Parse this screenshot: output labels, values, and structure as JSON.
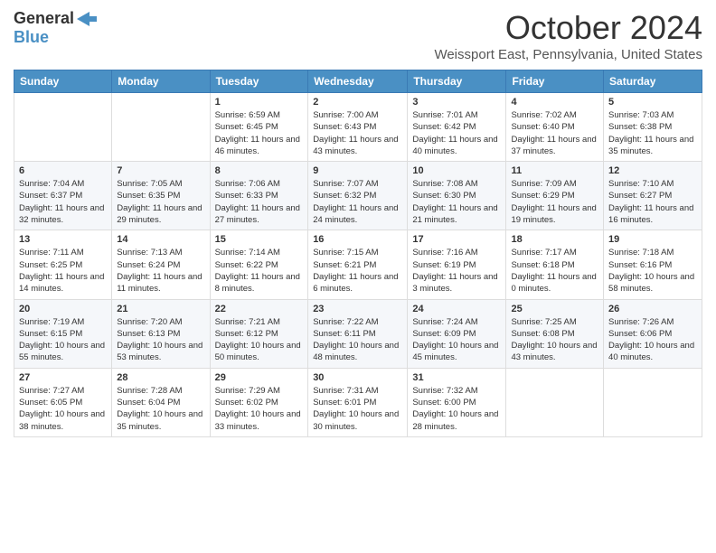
{
  "logo": {
    "general": "General",
    "blue": "Blue"
  },
  "header": {
    "month": "October 2024",
    "location": "Weissport East, Pennsylvania, United States"
  },
  "weekdays": [
    "Sunday",
    "Monday",
    "Tuesday",
    "Wednesday",
    "Thursday",
    "Friday",
    "Saturday"
  ],
  "weeks": [
    [
      {
        "day": "",
        "sunrise": "",
        "sunset": "",
        "daylight": ""
      },
      {
        "day": "",
        "sunrise": "",
        "sunset": "",
        "daylight": ""
      },
      {
        "day": "1",
        "sunrise": "Sunrise: 6:59 AM",
        "sunset": "Sunset: 6:45 PM",
        "daylight": "Daylight: 11 hours and 46 minutes."
      },
      {
        "day": "2",
        "sunrise": "Sunrise: 7:00 AM",
        "sunset": "Sunset: 6:43 PM",
        "daylight": "Daylight: 11 hours and 43 minutes."
      },
      {
        "day": "3",
        "sunrise": "Sunrise: 7:01 AM",
        "sunset": "Sunset: 6:42 PM",
        "daylight": "Daylight: 11 hours and 40 minutes."
      },
      {
        "day": "4",
        "sunrise": "Sunrise: 7:02 AM",
        "sunset": "Sunset: 6:40 PM",
        "daylight": "Daylight: 11 hours and 37 minutes."
      },
      {
        "day": "5",
        "sunrise": "Sunrise: 7:03 AM",
        "sunset": "Sunset: 6:38 PM",
        "daylight": "Daylight: 11 hours and 35 minutes."
      }
    ],
    [
      {
        "day": "6",
        "sunrise": "Sunrise: 7:04 AM",
        "sunset": "Sunset: 6:37 PM",
        "daylight": "Daylight: 11 hours and 32 minutes."
      },
      {
        "day": "7",
        "sunrise": "Sunrise: 7:05 AM",
        "sunset": "Sunset: 6:35 PM",
        "daylight": "Daylight: 11 hours and 29 minutes."
      },
      {
        "day": "8",
        "sunrise": "Sunrise: 7:06 AM",
        "sunset": "Sunset: 6:33 PM",
        "daylight": "Daylight: 11 hours and 27 minutes."
      },
      {
        "day": "9",
        "sunrise": "Sunrise: 7:07 AM",
        "sunset": "Sunset: 6:32 PM",
        "daylight": "Daylight: 11 hours and 24 minutes."
      },
      {
        "day": "10",
        "sunrise": "Sunrise: 7:08 AM",
        "sunset": "Sunset: 6:30 PM",
        "daylight": "Daylight: 11 hours and 21 minutes."
      },
      {
        "day": "11",
        "sunrise": "Sunrise: 7:09 AM",
        "sunset": "Sunset: 6:29 PM",
        "daylight": "Daylight: 11 hours and 19 minutes."
      },
      {
        "day": "12",
        "sunrise": "Sunrise: 7:10 AM",
        "sunset": "Sunset: 6:27 PM",
        "daylight": "Daylight: 11 hours and 16 minutes."
      }
    ],
    [
      {
        "day": "13",
        "sunrise": "Sunrise: 7:11 AM",
        "sunset": "Sunset: 6:25 PM",
        "daylight": "Daylight: 11 hours and 14 minutes."
      },
      {
        "day": "14",
        "sunrise": "Sunrise: 7:13 AM",
        "sunset": "Sunset: 6:24 PM",
        "daylight": "Daylight: 11 hours and 11 minutes."
      },
      {
        "day": "15",
        "sunrise": "Sunrise: 7:14 AM",
        "sunset": "Sunset: 6:22 PM",
        "daylight": "Daylight: 11 hours and 8 minutes."
      },
      {
        "day": "16",
        "sunrise": "Sunrise: 7:15 AM",
        "sunset": "Sunset: 6:21 PM",
        "daylight": "Daylight: 11 hours and 6 minutes."
      },
      {
        "day": "17",
        "sunrise": "Sunrise: 7:16 AM",
        "sunset": "Sunset: 6:19 PM",
        "daylight": "Daylight: 11 hours and 3 minutes."
      },
      {
        "day": "18",
        "sunrise": "Sunrise: 7:17 AM",
        "sunset": "Sunset: 6:18 PM",
        "daylight": "Daylight: 11 hours and 0 minutes."
      },
      {
        "day": "19",
        "sunrise": "Sunrise: 7:18 AM",
        "sunset": "Sunset: 6:16 PM",
        "daylight": "Daylight: 10 hours and 58 minutes."
      }
    ],
    [
      {
        "day": "20",
        "sunrise": "Sunrise: 7:19 AM",
        "sunset": "Sunset: 6:15 PM",
        "daylight": "Daylight: 10 hours and 55 minutes."
      },
      {
        "day": "21",
        "sunrise": "Sunrise: 7:20 AM",
        "sunset": "Sunset: 6:13 PM",
        "daylight": "Daylight: 10 hours and 53 minutes."
      },
      {
        "day": "22",
        "sunrise": "Sunrise: 7:21 AM",
        "sunset": "Sunset: 6:12 PM",
        "daylight": "Daylight: 10 hours and 50 minutes."
      },
      {
        "day": "23",
        "sunrise": "Sunrise: 7:22 AM",
        "sunset": "Sunset: 6:11 PM",
        "daylight": "Daylight: 10 hours and 48 minutes."
      },
      {
        "day": "24",
        "sunrise": "Sunrise: 7:24 AM",
        "sunset": "Sunset: 6:09 PM",
        "daylight": "Daylight: 10 hours and 45 minutes."
      },
      {
        "day": "25",
        "sunrise": "Sunrise: 7:25 AM",
        "sunset": "Sunset: 6:08 PM",
        "daylight": "Daylight: 10 hours and 43 minutes."
      },
      {
        "day": "26",
        "sunrise": "Sunrise: 7:26 AM",
        "sunset": "Sunset: 6:06 PM",
        "daylight": "Daylight: 10 hours and 40 minutes."
      }
    ],
    [
      {
        "day": "27",
        "sunrise": "Sunrise: 7:27 AM",
        "sunset": "Sunset: 6:05 PM",
        "daylight": "Daylight: 10 hours and 38 minutes."
      },
      {
        "day": "28",
        "sunrise": "Sunrise: 7:28 AM",
        "sunset": "Sunset: 6:04 PM",
        "daylight": "Daylight: 10 hours and 35 minutes."
      },
      {
        "day": "29",
        "sunrise": "Sunrise: 7:29 AM",
        "sunset": "Sunset: 6:02 PM",
        "daylight": "Daylight: 10 hours and 33 minutes."
      },
      {
        "day": "30",
        "sunrise": "Sunrise: 7:31 AM",
        "sunset": "Sunset: 6:01 PM",
        "daylight": "Daylight: 10 hours and 30 minutes."
      },
      {
        "day": "31",
        "sunrise": "Sunrise: 7:32 AM",
        "sunset": "Sunset: 6:00 PM",
        "daylight": "Daylight: 10 hours and 28 minutes."
      },
      {
        "day": "",
        "sunrise": "",
        "sunset": "",
        "daylight": ""
      },
      {
        "day": "",
        "sunrise": "",
        "sunset": "",
        "daylight": ""
      }
    ]
  ]
}
